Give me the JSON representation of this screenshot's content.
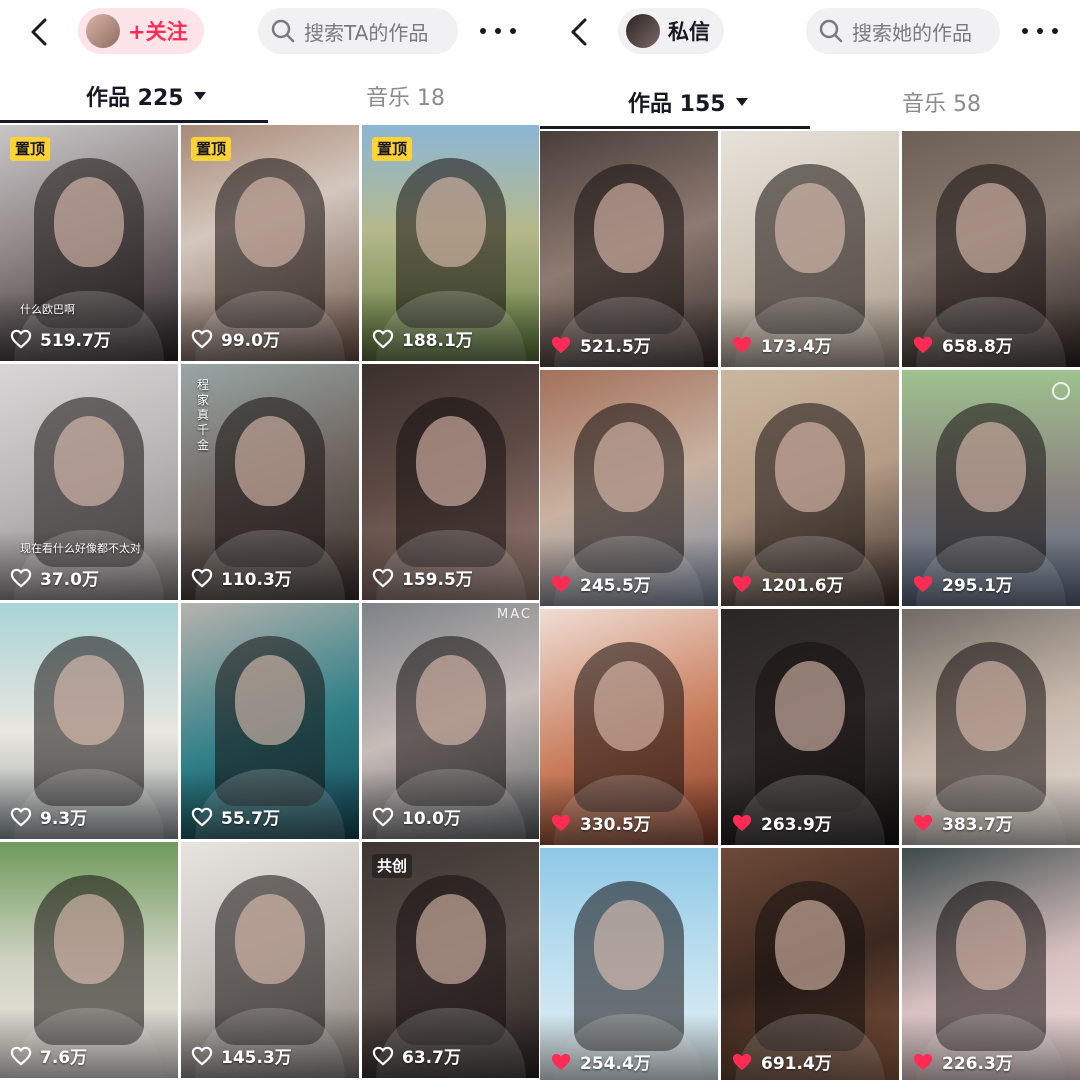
{
  "colors": {
    "brand_red": "#fe2c55",
    "pin_yellow": "#ffd235",
    "text_dark": "#161823",
    "text_grey": "#8a8b91"
  },
  "icons": {
    "back": "chevron-left",
    "search": "magnifier",
    "more": "three-dots",
    "like": "heart"
  },
  "left": {
    "follow_label": "+关注",
    "search_placeholder": "搜索TA的作品",
    "tabs": {
      "works": "作品 225",
      "music": "音乐 18"
    },
    "videos": [
      {
        "likes": "519.7万",
        "badge": "置顶",
        "caption": "什么欧巴啊",
        "liked": false
      },
      {
        "likes": "99.0万",
        "badge": "置顶",
        "liked": false
      },
      {
        "likes": "188.1万",
        "badge": "置顶",
        "liked": false
      },
      {
        "likes": "37.0万",
        "caption": "现在看什么好像都不太对",
        "liked": false
      },
      {
        "likes": "110.3万",
        "vertical_text": "程家真千金",
        "liked": false
      },
      {
        "likes": "159.5万",
        "liked": false
      },
      {
        "likes": "9.3万",
        "liked": false
      },
      {
        "likes": "55.7万",
        "liked": false
      },
      {
        "likes": "10.0万",
        "watermark": "MAC",
        "liked": false
      },
      {
        "likes": "7.6万",
        "liked": false
      },
      {
        "likes": "145.3万",
        "liked": false
      },
      {
        "likes": "63.7万",
        "badge": "共创",
        "liked": false
      }
    ]
  },
  "right": {
    "dm_label": "私信",
    "search_placeholder": "搜索她的作品",
    "tabs": {
      "works": "作品 155",
      "music": "音乐 58"
    },
    "videos": [
      {
        "likes": "521.5万",
        "liked": true
      },
      {
        "likes": "173.4万",
        "liked": true
      },
      {
        "likes": "658.8万",
        "liked": true
      },
      {
        "likes": "245.5万",
        "liked": true
      },
      {
        "likes": "1201.6万",
        "liked": true
      },
      {
        "likes": "295.1万",
        "liked": true
      },
      {
        "likes": "330.5万",
        "liked": true
      },
      {
        "likes": "263.9万",
        "liked": true
      },
      {
        "likes": "383.7万",
        "liked": true
      },
      {
        "likes": "254.4万",
        "liked": true
      },
      {
        "likes": "691.4万",
        "liked": true
      },
      {
        "likes": "226.3万",
        "liked": true
      }
    ]
  }
}
